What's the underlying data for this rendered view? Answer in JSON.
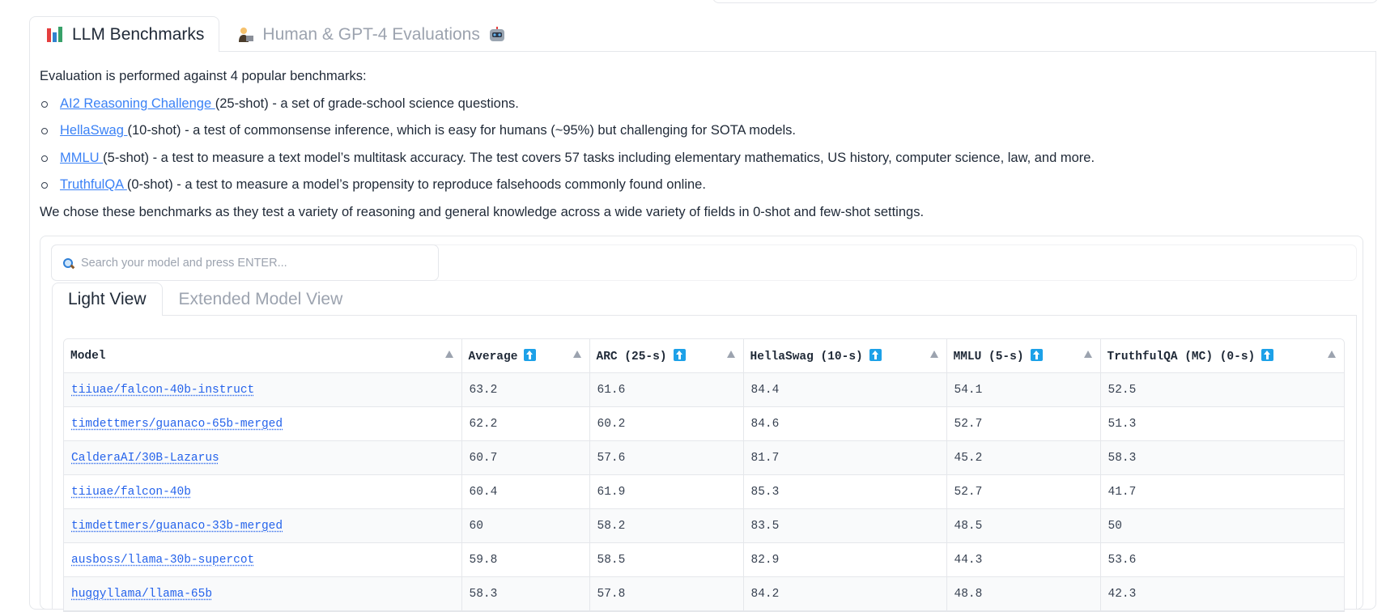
{
  "tabs": {
    "benchmarks_label": "LLM Benchmarks",
    "human_eval_label": "Human & GPT-4 Evaluations"
  },
  "intro": {
    "lead": "Evaluation is performed against 4 popular benchmarks:",
    "benchmarks": [
      {
        "name": "AI2 Reasoning Challenge ",
        "detail": "(25-shot) - a set of grade-school science questions."
      },
      {
        "name": "HellaSwag ",
        "detail": "(10-shot) - a test of commonsense inference, which is easy for humans (~95%) but challenging for SOTA models."
      },
      {
        "name": "MMLU ",
        "detail": "(5-shot) - a test to measure a text model’s multitask accuracy. The test covers 57 tasks including elementary mathematics, US history, computer science, law, and more."
      },
      {
        "name": "TruthfulQA ",
        "detail": "(0-shot) - a test to measure a model’s propensity to reproduce falsehoods commonly found online."
      }
    ],
    "closing": "We chose these benchmarks as they test a variety of reasoning and general knowledge across a wide variety of fields in 0-shot and few-shot settings."
  },
  "search": {
    "placeholder": "Search your model and press ENTER..."
  },
  "view_tabs": {
    "light": "Light View",
    "extended": "Extended Model View"
  },
  "table": {
    "headers": {
      "model": "Model",
      "average": "Average",
      "arc": "ARC (25-s)",
      "hellaswag": "HellaSwag (10-s)",
      "mmlu": "MMLU (5-s)",
      "truthfulqa": "TruthfulQA (MC) (0-s)"
    },
    "rows": [
      {
        "model": "tiiuae/falcon-40b-instruct",
        "average": "63.2",
        "arc": "61.6",
        "hellaswag": "84.4",
        "mmlu": "54.1",
        "truthfulqa": "52.5"
      },
      {
        "model": "timdettmers/guanaco-65b-merged",
        "average": "62.2",
        "arc": "60.2",
        "hellaswag": "84.6",
        "mmlu": "52.7",
        "truthfulqa": "51.3"
      },
      {
        "model": "CalderaAI/30B-Lazarus",
        "average": "60.7",
        "arc": "57.6",
        "hellaswag": "81.7",
        "mmlu": "45.2",
        "truthfulqa": "58.3"
      },
      {
        "model": "tiiuae/falcon-40b",
        "average": "60.4",
        "arc": "61.9",
        "hellaswag": "85.3",
        "mmlu": "52.7",
        "truthfulqa": "41.7"
      },
      {
        "model": "timdettmers/guanaco-33b-merged",
        "average": "60",
        "arc": "58.2",
        "hellaswag": "83.5",
        "mmlu": "48.5",
        "truthfulqa": "50"
      },
      {
        "model": "ausboss/llama-30b-supercot",
        "average": "59.8",
        "arc": "58.5",
        "hellaswag": "82.9",
        "mmlu": "44.3",
        "truthfulqa": "53.6"
      },
      {
        "model": "huggyllama/llama-65b",
        "average": "58.3",
        "arc": "57.8",
        "hellaswag": "84.2",
        "mmlu": "48.8",
        "truthfulqa": "42.3"
      }
    ]
  },
  "colors": {
    "link": "#3b82f6",
    "border": "#e5e7eb",
    "sort_badge": "#1da1e8"
  }
}
